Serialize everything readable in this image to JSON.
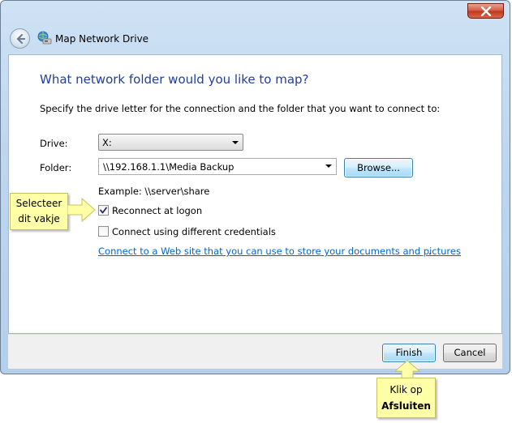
{
  "window": {
    "title": "Map Network Drive"
  },
  "main": {
    "heading": "What network folder would you like to map?",
    "instruction": "Specify the drive letter for the connection and the folder that you want to connect to:",
    "drive_label": "Drive:",
    "drive_value": "X:",
    "folder_label": "Folder:",
    "folder_value": "\\\\192.168.1.1\\Media Backup",
    "browse_label": "Browse...",
    "example_text": "Example: \\\\server\\share",
    "reconnect_label": "Reconnect at logon",
    "reconnect_checked": true,
    "credentials_label": "Connect using different credentials",
    "credentials_checked": false,
    "web_link": "Connect to a Web site that you can use to store your documents and pictures",
    "link_suffix": "."
  },
  "footer": {
    "finish_label": "Finish",
    "cancel_label": "Cancel"
  },
  "callouts": {
    "checkbox_line1": "Selecteer",
    "checkbox_line2": "dit vakje",
    "finish_line1": "Klik op",
    "finish_line2": "Afsluiten"
  },
  "colors": {
    "heading": "#1e3f9d",
    "link": "#0066cc",
    "callout_bg": "#ffffa8",
    "close_button": "#c1391c"
  },
  "icons": {
    "close": "close-icon",
    "back": "back-arrow-icon",
    "network_drive": "network-drive-icon",
    "dropdown": "chevron-down-icon",
    "checkmark": "checkmark-icon"
  }
}
